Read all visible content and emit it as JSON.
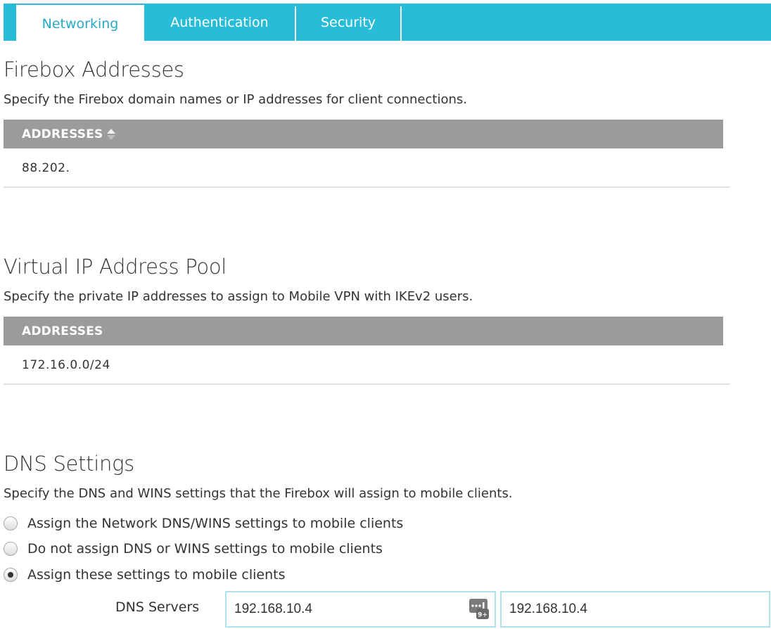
{
  "tabs": [
    {
      "label": "Networking",
      "active": true
    },
    {
      "label": "Authentication",
      "active": false
    },
    {
      "label": "Security",
      "active": false
    }
  ],
  "firebox_addresses": {
    "title": "Firebox Addresses",
    "description": "Specify the Firebox domain names or IP addresses for client connections.",
    "column_header": "ADDRESSES",
    "sort_icon": "sort-ascending-icon",
    "rows": [
      "88.202."
    ]
  },
  "virtual_ip_pool": {
    "title": "Virtual IP Address Pool",
    "description": "Specify the private IP addresses to assign to Mobile VPN with IKEv2 users.",
    "column_header": "ADDRESSES",
    "rows": [
      "172.16.0.0/24"
    ]
  },
  "dns_settings": {
    "title": "DNS Settings",
    "description": "Specify the DNS and WINS settings that the Firebox will assign to mobile clients.",
    "options": [
      {
        "label": "Assign the Network DNS/WINS settings to mobile clients",
        "checked": false
      },
      {
        "label": "Do not assign DNS or WINS settings to mobile clients",
        "checked": false
      },
      {
        "label": "Assign these settings to mobile clients",
        "checked": true
      }
    ],
    "dns_servers_label": "DNS Servers",
    "dns_server_1": "192.168.10.4",
    "dns_server_2": "192.168.10.4",
    "keypad_icon": "numeric-keypad-icon",
    "keypad_badge": "9+"
  },
  "colors": {
    "accent": "#29bcd9",
    "table_header": "#9b9b9b",
    "input_border": "#aee3ee"
  }
}
